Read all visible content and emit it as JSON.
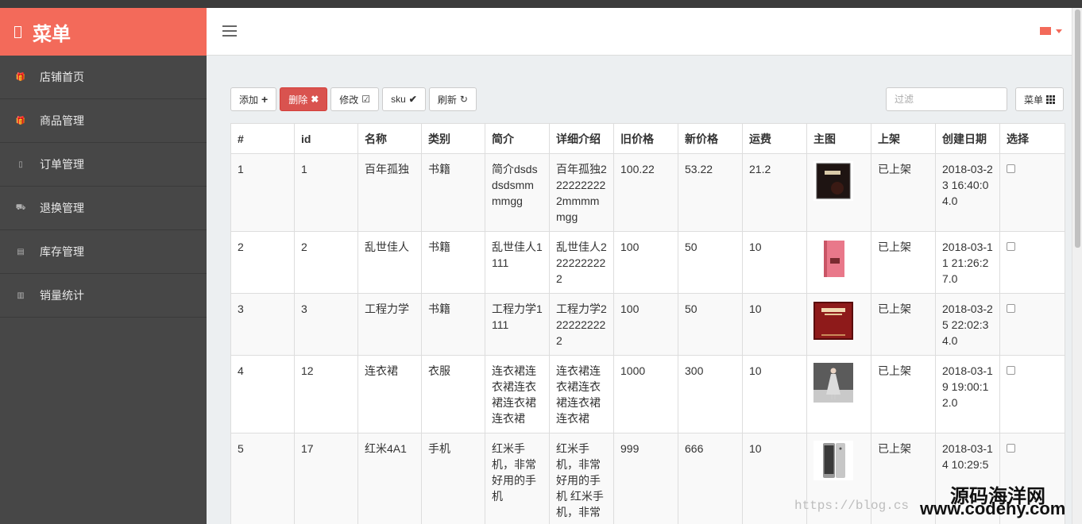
{
  "brand": {
    "title": "菜单"
  },
  "sidebar": {
    "items": [
      {
        "label": "店铺首页",
        "icon": "gift-icon"
      },
      {
        "label": "商品管理",
        "icon": "gift-icon"
      },
      {
        "label": "订单管理",
        "icon": "mobile-icon"
      },
      {
        "label": "退换管理",
        "icon": "truck-icon"
      },
      {
        "label": "库存管理",
        "icon": "list-icon"
      },
      {
        "label": "销量统计",
        "icon": "bar-chart-icon"
      }
    ]
  },
  "header": {
    "menu_icon": "hamburger-icon",
    "mail_icon": "envelope-icon",
    "accent": "#f36a5a"
  },
  "toolbar": {
    "add_label": "添加",
    "delete_label": "删除",
    "edit_label": "修改",
    "sku_label": "sku",
    "refresh_label": "刷新",
    "filter_placeholder": "过滤",
    "columns_label": "菜单"
  },
  "table": {
    "headers": [
      "#",
      "id",
      "名称",
      "类别",
      "简介",
      "详细介绍",
      "旧价格",
      "新价格",
      "运费",
      "主图",
      "上架",
      "创建日期",
      "选择"
    ],
    "rows": [
      {
        "num": "1",
        "id": "1",
        "name": "百年孤独",
        "category": "书籍",
        "intro": "简介dsdsdsdsmmmmgg",
        "detail": "百年孤独2222222222mmmmmgg",
        "old_price": "100.22",
        "new_price": "53.22",
        "shipping": "21.2",
        "image": "book-black",
        "status": "已上架",
        "created": "2018-03-23 16:40:04.0"
      },
      {
        "num": "2",
        "id": "2",
        "name": "乱世佳人",
        "category": "书籍",
        "intro": "乱世佳人1111",
        "detail": "乱世佳人2222222222",
        "old_price": "100",
        "new_price": "50",
        "shipping": "10",
        "image": "book-pink",
        "status": "已上架",
        "created": "2018-03-11 21:26:27.0"
      },
      {
        "num": "3",
        "id": "3",
        "name": "工程力学",
        "category": "书籍",
        "intro": "工程力学1111",
        "detail": "工程力学2222222222",
        "old_price": "100",
        "new_price": "50",
        "shipping": "10",
        "image": "book-red",
        "status": "已上架",
        "created": "2018-03-25 22:02:34.0"
      },
      {
        "num": "4",
        "id": "12",
        "name": "连衣裙",
        "category": "衣服",
        "intro": "连衣裙连衣裙连衣裙连衣裙连衣裙",
        "detail": "连衣裙连衣裙连衣裙连衣裙连衣裙",
        "old_price": "1000",
        "new_price": "300",
        "shipping": "10",
        "image": "dress",
        "status": "已上架",
        "created": "2018-03-19 19:00:12.0"
      },
      {
        "num": "5",
        "id": "17",
        "name": "红米4A1",
        "category": "手机",
        "intro": "红米手机，非常好用的手机",
        "detail": "红米手机，非常好用的手机 红米手机，非常",
        "old_price": "999",
        "new_price": "666",
        "shipping": "10",
        "image": "phone",
        "status": "已上架",
        "created": "2018-03-14 10:29:5"
      }
    ]
  },
  "watermark": {
    "blog": "https://blog.cs",
    "site_name": "源码海洋网",
    "site_url": "www.codehy.com"
  }
}
